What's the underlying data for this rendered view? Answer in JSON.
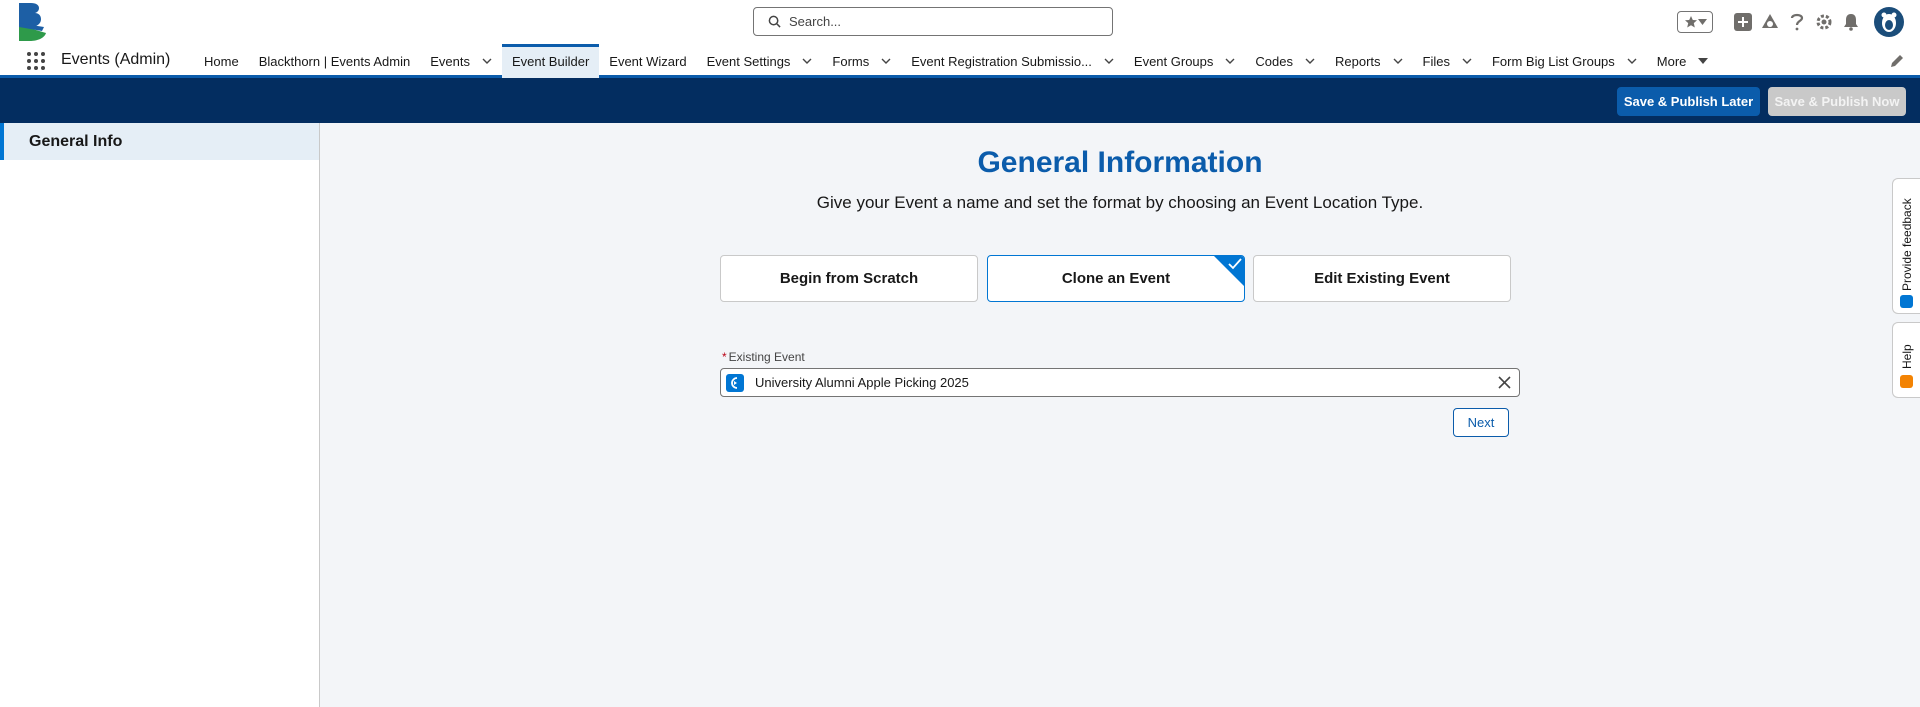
{
  "search": {
    "placeholder": "Search..."
  },
  "app": {
    "name": "Events (Admin)"
  },
  "nav": {
    "items": [
      {
        "label": "Home",
        "dropdown": false,
        "active": false
      },
      {
        "label": "Blackthorn | Events Admin",
        "dropdown": false,
        "active": false
      },
      {
        "label": "Events",
        "dropdown": true,
        "active": false
      },
      {
        "label": "Event Builder",
        "dropdown": false,
        "active": true
      },
      {
        "label": "Event Wizard",
        "dropdown": false,
        "active": false
      },
      {
        "label": "Event Settings",
        "dropdown": true,
        "active": false
      },
      {
        "label": "Forms",
        "dropdown": true,
        "active": false
      },
      {
        "label": "Event Registration Submissio...",
        "dropdown": true,
        "active": false
      },
      {
        "label": "Event Groups",
        "dropdown": true,
        "active": false
      },
      {
        "label": "Codes",
        "dropdown": true,
        "active": false
      },
      {
        "label": "Reports",
        "dropdown": true,
        "active": false
      },
      {
        "label": "Files",
        "dropdown": true,
        "active": false
      },
      {
        "label": "Form Big List Groups",
        "dropdown": true,
        "active": false
      },
      {
        "label": "More",
        "dropdown": true,
        "active": false
      }
    ]
  },
  "actions": {
    "save_publish_later": "Save & Publish Later",
    "save_publish_now": "Save & Publish Now"
  },
  "sidebar": {
    "items": [
      {
        "label": "General Info",
        "active": true
      }
    ]
  },
  "main": {
    "title": "General Information",
    "subtitle": "Give your Event a name and set the format by choosing an Event Location Type.",
    "choices": [
      {
        "label": "Begin from Scratch",
        "selected": false
      },
      {
        "label": "Clone an Event",
        "selected": true
      },
      {
        "label": "Edit Existing Event",
        "selected": false
      }
    ],
    "field": {
      "required_marker": "*",
      "label": "Existing Event",
      "value": "University Alumni Apple Picking 2025"
    },
    "next_label": "Next"
  },
  "side_tabs": {
    "feedback": "Provide feedback",
    "help": "Help"
  },
  "colors": {
    "brand_blue": "#0b5cab",
    "dark_band": "#032d60",
    "accent": "#0176d3",
    "disabled": "#c9c9c9"
  }
}
